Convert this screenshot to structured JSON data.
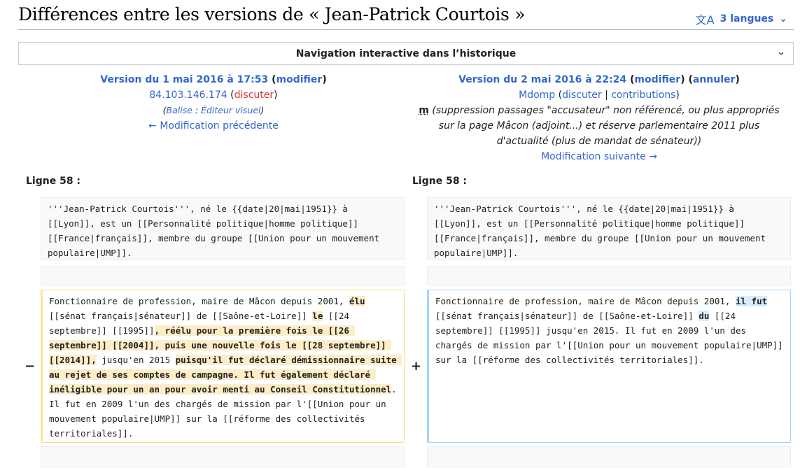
{
  "page": {
    "title": "Différences entre les versions de « Jean-Patrick Courtois »",
    "lang_icon": "translate-icon",
    "lang_label": "3 langues",
    "nav_label": "Navigation interactive dans l’historique"
  },
  "left": {
    "version_link": "Version du 1 mai 2016 à 17:53",
    "modify": "modifier",
    "user": "84.103.146.174",
    "talk": "discuter",
    "tag_label": "Balise",
    "tag_value": "Éditeur visuel",
    "prev_link": "← Modification précédente",
    "line_header": "Ligne 58 :"
  },
  "right": {
    "version_link": "Version du 2 mai 2016 à 22:24",
    "modify": "modifier",
    "undo": "annuler",
    "user": "Mdomp",
    "talk": "discuter",
    "contribs": "contributions",
    "minor": "m",
    "summary": "(suppression passages \"accusateur\" non référencé, ou plus appropriés sur la page Mâcon (adjoint...) et réserve parlementaire 2011 plus d'actualité (plus de mandat de sénateur))",
    "next_link": "Modification suivante →",
    "line_header": "Ligne 58 :"
  },
  "diff": {
    "context_text": "'''Jean-Patrick Courtois''', né le {{date|20|mai|1951}} à [[Lyon]], est un [[Personnalité politique|homme politique]] [[France|français]], membre du groupe [[Union pour un mouvement populaire|UMP]].",
    "minus": "−",
    "plus": "+",
    "del_parts": [
      "Fonctionnaire de profession, maire de Mâcon depuis 2001, ",
      "élu",
      " [[sénat français|sénateur]] de [[Saône-et-Loire]] ",
      "le",
      " [[24 septembre]] [[1995]]",
      ", réélu pour la première fois le [[26 septembre]] [[2004]], puis une nouvelle fois le [[28 septembre]] [[2014]],",
      " jusqu'en 2015 ",
      "puisqu'il fut déclaré démissionnaire suite au rejet de ses comptes de campagne. Il fut également déclaré inéligible pour un an pour avoir menti au Conseil Constitutionnel",
      ". Il fut en 2009 l'un des chargés de mission par l'[[Union pour un mouvement populaire|UMP]] sur la [[réforme des collectivités territoriales]]."
    ],
    "add_parts": [
      "Fonctionnaire de profession, maire de Mâcon depuis 2001, ",
      "il fut",
      " [[sénat français|sénateur]] de [[Saône-et-Loire]] ",
      "du",
      " [[24 septembre]] [[1995]] jusqu'en 2015. Il fut en 2009 l'un des chargés de mission par l'[[Union pour un mouvement populaire|UMP]] sur la [[réforme des collectivités territoriales]]."
    ]
  }
}
